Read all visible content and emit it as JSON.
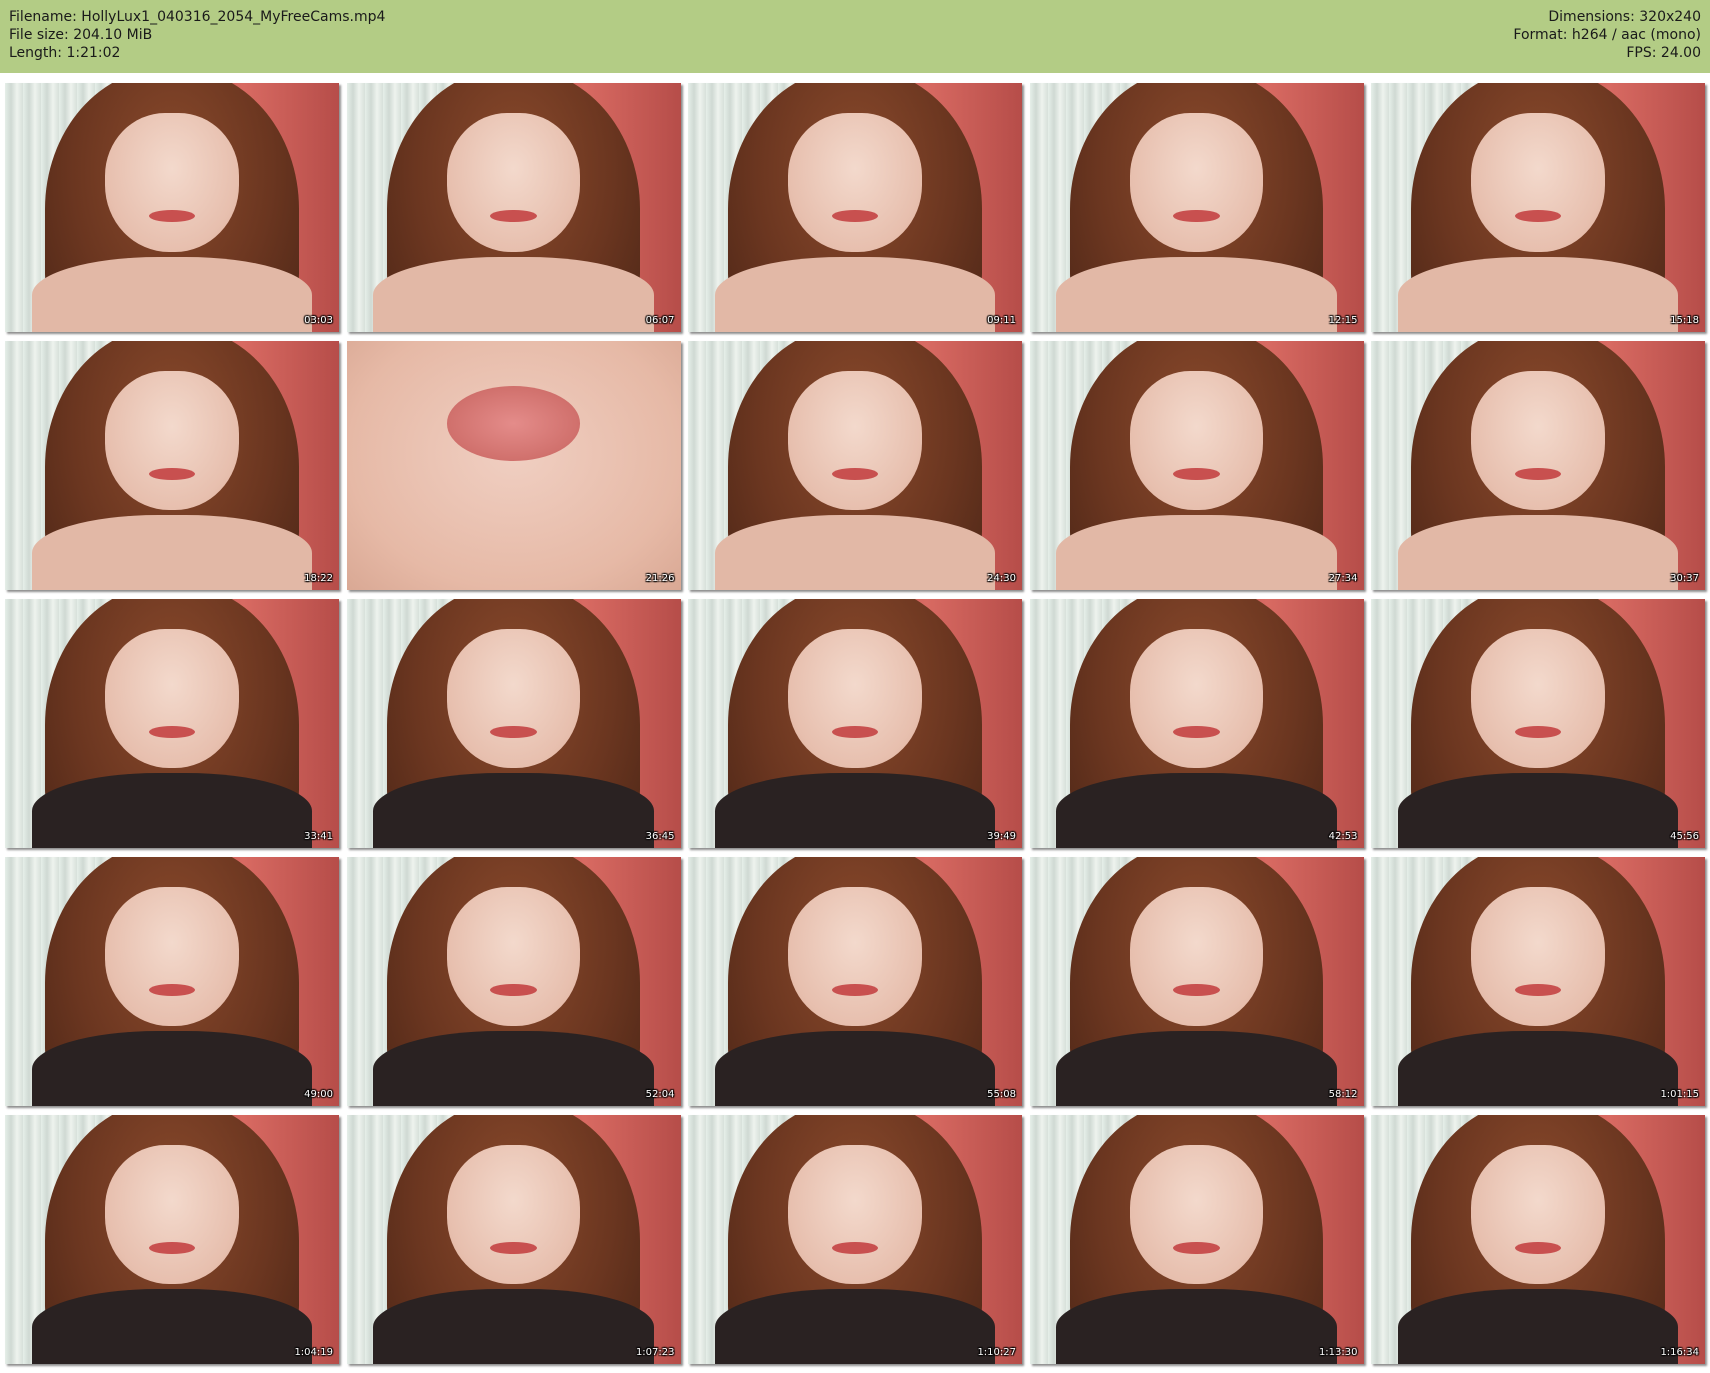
{
  "header": {
    "filename": "Filename: HollyLux1_040316_2054_MyFreeCams.mp4",
    "filesize": "File size: 204.10 MiB",
    "length": "Length: 1:21:02",
    "dimensions": "Dimensions: 320x240",
    "format": "Format: h264 / aac (mono)",
    "fps": "FPS: 24.00",
    "background_color": "#b3cc85"
  },
  "thumbnails": [
    {
      "time": "03:03",
      "type": "face-skin"
    },
    {
      "time": "06:07",
      "type": "face-skin"
    },
    {
      "time": "09:11",
      "type": "face-skin"
    },
    {
      "time": "12:15",
      "type": "face-skin"
    },
    {
      "time": "15:18",
      "type": "face-skin"
    },
    {
      "time": "18:22",
      "type": "face-skin"
    },
    {
      "time": "21:26",
      "type": "lips-closeup"
    },
    {
      "time": "24:30",
      "type": "face-skin"
    },
    {
      "time": "27:34",
      "type": "face-skin"
    },
    {
      "time": "30:37",
      "type": "face-skin"
    },
    {
      "time": "33:41",
      "type": "face"
    },
    {
      "time": "36:45",
      "type": "face"
    },
    {
      "time": "39:49",
      "type": "face"
    },
    {
      "time": "42:53",
      "type": "face"
    },
    {
      "time": "45:56",
      "type": "face"
    },
    {
      "time": "49:00",
      "type": "face"
    },
    {
      "time": "52:04",
      "type": "face"
    },
    {
      "time": "55:08",
      "type": "face"
    },
    {
      "time": "58:12",
      "type": "face"
    },
    {
      "time": "1:01:15",
      "type": "face"
    },
    {
      "time": "1:04:19",
      "type": "face"
    },
    {
      "time": "1:07:23",
      "type": "face"
    },
    {
      "time": "1:10:27",
      "type": "face"
    },
    {
      "time": "1:13:30",
      "type": "face"
    },
    {
      "time": "1:16:34",
      "type": "face"
    }
  ]
}
